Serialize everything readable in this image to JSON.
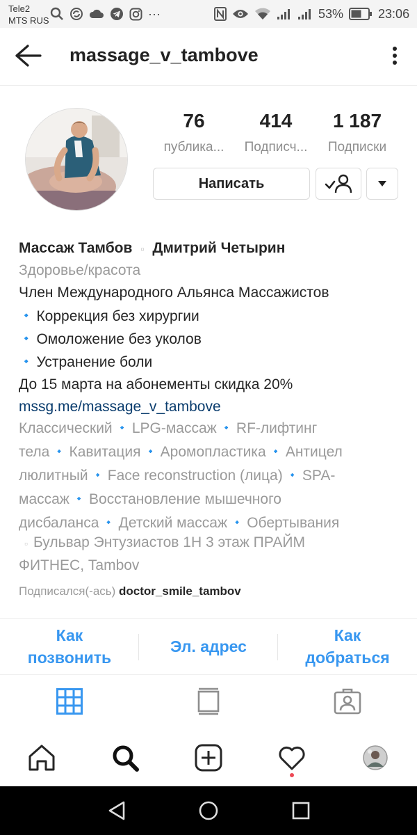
{
  "status_bar": {
    "carrier_line1": "Tele2",
    "carrier_line2": "MTS RUS",
    "battery_percent": "53%",
    "time": "23:06",
    "overflow": "···"
  },
  "header": {
    "username": "massage_v_tambove"
  },
  "stats": [
    {
      "value": "76",
      "label": "публика..."
    },
    {
      "value": "414",
      "label": "Подписч..."
    },
    {
      "value": "1 187",
      "label": "Подписки"
    }
  ],
  "buttons": {
    "message": "Написать"
  },
  "bio": {
    "name": "Массаж Тамбов",
    "name_sep": "▫",
    "name2": "Дмитрий Четырин",
    "category": "Здоровье/красота",
    "line1": "Член Международного Альянса Массажистов",
    "bullets": [
      "Коррекция без хирургии",
      "Омоложение без уколов",
      "Устранение боли"
    ],
    "bullet_symbol": "🔹",
    "promo": "До 15 марта на абонементы скидка 20%",
    "link": "mssg.me/massage_v_tambove",
    "services_lines": [
      [
        "Классический",
        "LPG-массаж",
        "RF-лифтинг"
      ],
      [
        "тела",
        "Кавитация",
        "Аромопластика",
        "Антицел"
      ],
      [
        "люлитный",
        "Face reconstruction (лица)",
        "SPA-"
      ],
      [
        "массаж",
        "Восстановление мышечного"
      ],
      [
        "дисбаланса",
        "Детский массаж",
        "Обертывания"
      ]
    ],
    "address_symbol": "▫",
    "address_line1": "Бульвар Энтузиастов 1Н 3 этаж ПРАЙМ",
    "address_line2": "ФИТНЕС, Tambov",
    "followed_by_label": "Подписался(-ась)",
    "followed_by_user": "doctor_smile_tambov"
  },
  "contact": {
    "call": [
      "Как",
      "позвонить"
    ],
    "email": "Эл. адрес",
    "directions": [
      "Как",
      "добраться"
    ]
  },
  "icons": {
    "status": [
      "search-icon",
      "sync-icon",
      "cloud-icon",
      "telegram-icon",
      "instagram-icon",
      "nfc-icon",
      "eye-icon",
      "wifi-icon",
      "signal-icon",
      "battery-icon"
    ],
    "tabs": [
      "grid-icon",
      "feed-icon",
      "tagged-icon"
    ],
    "nav": [
      "home-icon",
      "search-icon",
      "add-icon",
      "heart-icon",
      "profile-avatar"
    ],
    "system": [
      "back-triangle-icon",
      "home-circle-icon",
      "recents-square-icon"
    ]
  },
  "colors": {
    "accent": "#3897f0",
    "link": "#0b3d6e",
    "secondary_text": "#9a9a9a",
    "activity_dot": "#ed4956"
  }
}
